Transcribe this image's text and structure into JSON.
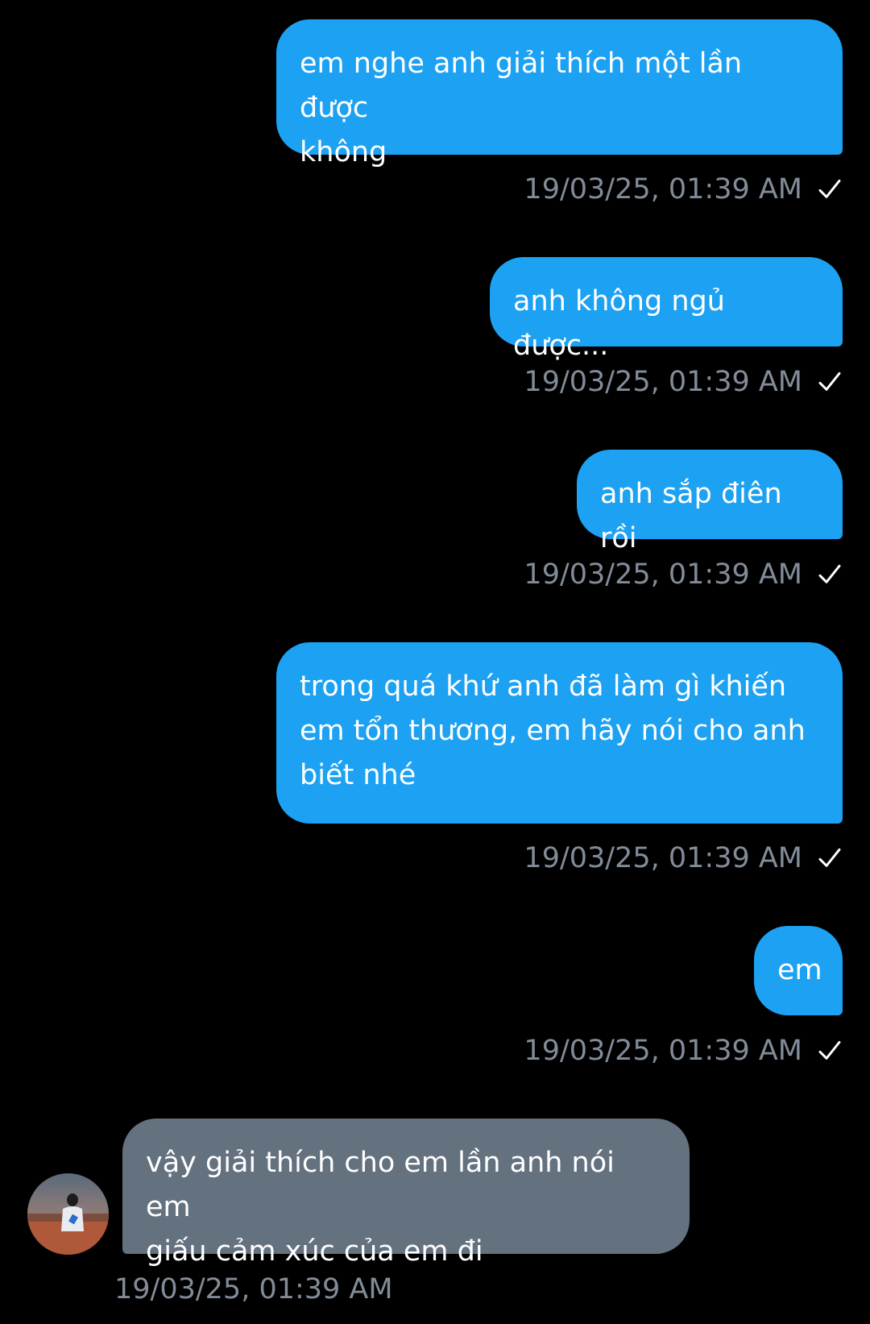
{
  "colors": {
    "background": "#000000",
    "sent_bubble": "#1da1f2",
    "received_bubble": "#64717f",
    "timestamp": "#828c99",
    "text": "#ffffff"
  },
  "messages": [
    {
      "direction": "sent",
      "text": "em nghe anh giải thích một lần được\nkhông",
      "timestamp": "19/03/25, 01:39 AM",
      "status_icon": "check-icon"
    },
    {
      "direction": "sent",
      "text": "anh không ngủ được...",
      "timestamp": "19/03/25, 01:39 AM",
      "status_icon": "check-icon"
    },
    {
      "direction": "sent",
      "text": "anh sắp điên rồi",
      "timestamp": "19/03/25, 01:39 AM",
      "status_icon": "check-icon"
    },
    {
      "direction": "sent",
      "text": "trong quá khứ anh đã làm gì khiến\nem tổn thương, em hãy nói cho anh\nbiết nhé",
      "timestamp": "19/03/25, 01:39 AM",
      "status_icon": "check-icon"
    },
    {
      "direction": "sent",
      "text": "em",
      "timestamp": "19/03/25, 01:39 AM",
      "status_icon": "check-icon"
    },
    {
      "direction": "received",
      "text": "vậy giải thích cho em lần anh nói em\ngiấu cảm xúc của em đi",
      "timestamp": "19/03/25, 01:39 AM",
      "avatar_icon": "user-avatar"
    }
  ]
}
